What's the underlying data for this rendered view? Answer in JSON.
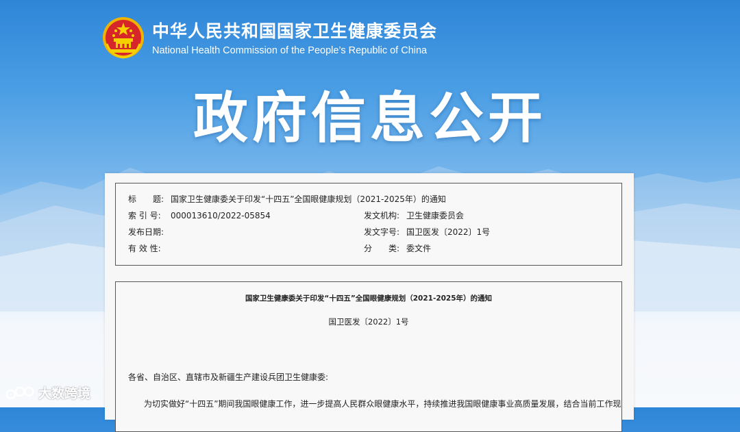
{
  "header": {
    "title_cn": "中华人民共和国国家卫生健康委员会",
    "title_en": "National Health Commission of the People’s  Republic of China"
  },
  "banner": {
    "title": "政府信息公开"
  },
  "meta": {
    "title_label": "标　　题:",
    "title_value": "国家卫生健康委关于印发“十四五”全国眼健康规划（2021-2025年）的通知",
    "index_label": "索  引  号:",
    "index_value": "000013610/2022-05854",
    "issuer_label": "发文机构:",
    "issuer_value": "卫生健康委员会",
    "date_label": "发布日期:",
    "date_value": "",
    "docno_label": "发文字号:",
    "docno_value": "国卫医发〔2022〕1号",
    "validity_label": "有  效  性:",
    "validity_value": "",
    "category_label": "分　　类:",
    "category_value": "委文件"
  },
  "document": {
    "title": "国家卫生健康委关于印发“十四五”全国眼健康规划（2021-2025年）的通知",
    "number": "国卫医发〔2022〕1号",
    "addressee": "各省、自治区、直辖市及新疆生产建设兵团卫生健康委:",
    "body_first_line": "为切实做好“十四五”期间我国眼健康工作，进一步提高人民群众眼健康水平，持续推进我国眼健康事业高质量发展，结合当前工作现"
  },
  "watermark": {
    "text": "大数跨境"
  },
  "icons": {
    "emblem": "national-emblem-icon",
    "watermark_logo": "dashu-logo-icon"
  },
  "colors": {
    "sky_top": "#2f86d8",
    "emblem_red": "#d7262a",
    "emblem_gold": "#f5c400"
  }
}
